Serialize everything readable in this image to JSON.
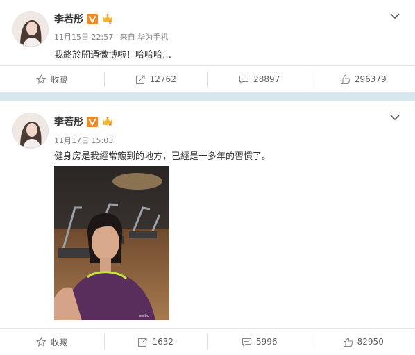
{
  "posts": [
    {
      "author": "李若彤",
      "date": "11月15日 22:57",
      "source": "来自 华为手机",
      "text": "我終於開通微博啦！哈哈哈…",
      "actions": {
        "favorite": "收藏",
        "repost": "12762",
        "comment": "28897",
        "like": "296379"
      }
    },
    {
      "author": "李若彤",
      "date": "11月17日 15:03",
      "text": "健身房是我經常簸到的地方，已經是十多年的習慣了。",
      "actions": {
        "favorite": "收藏",
        "repost": "1632",
        "comment": "5996",
        "like": "82950"
      }
    }
  ],
  "colors": {
    "verified_badge": "#f08a24",
    "separator": "#d7e7ef"
  }
}
